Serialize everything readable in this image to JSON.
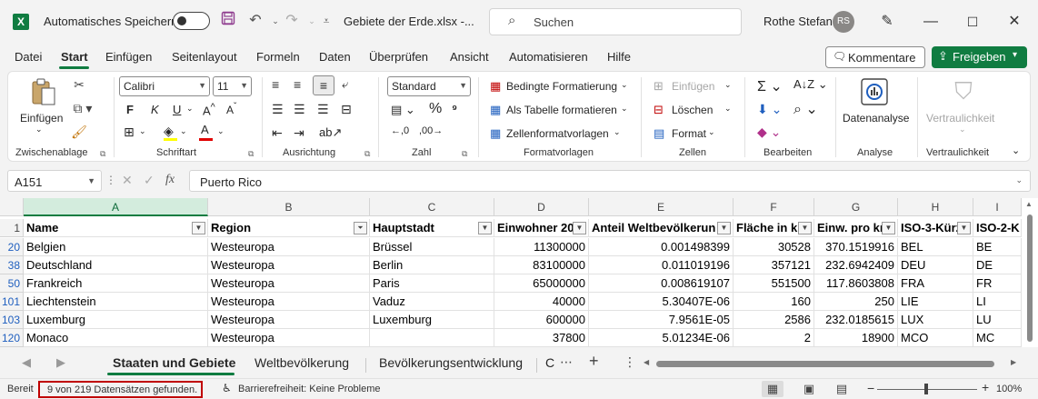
{
  "titlebar": {
    "autosave_label": "Automatisches Speichern",
    "file_title": "Gebiete der Erde.xlsx  -...",
    "search_placeholder": "Suchen",
    "user_name": "Rothe Stefan",
    "user_initials": "RS",
    "app_icon": "X"
  },
  "menu": {
    "tabs": [
      "Datei",
      "Start",
      "Einfügen",
      "Seitenlayout",
      "Formeln",
      "Daten",
      "Überprüfen",
      "Ansicht",
      "Automatisieren",
      "Hilfe"
    ],
    "active": "Start",
    "comment_label": "Kommentare",
    "share_label": "Freigeben"
  },
  "ribbon": {
    "clipboard": {
      "paste": "Einfügen",
      "label": "Zwischenablage"
    },
    "font": {
      "name": "Calibri",
      "size": "11",
      "label": "Schriftart",
      "bold": "F",
      "italic": "K",
      "underline": "U"
    },
    "alignment": {
      "label": "Ausrichtung"
    },
    "number": {
      "format": "Standard",
      "label": "Zahl"
    },
    "styles": {
      "conditional": "Bedingte Formatierung",
      "as_table": "Als Tabelle formatieren",
      "cell_styles": "Zellenformatvorlagen",
      "label": "Formatvorlagen"
    },
    "cells": {
      "insert": "Einfügen",
      "delete": "Löschen",
      "format": "Format",
      "label": "Zellen"
    },
    "editing": {
      "label": "Bearbeiten"
    },
    "analysis": {
      "button": "Datenanalyse",
      "label": "Analyse"
    },
    "sensitivity": {
      "button": "Vertraulichkeit",
      "label": "Vertraulichkeit"
    }
  },
  "formula_bar": {
    "name_box": "A151",
    "fx": "fx",
    "value": "Puerto Rico"
  },
  "grid": {
    "columns": [
      "A",
      "B",
      "C",
      "D",
      "E",
      "F",
      "G",
      "H",
      "I"
    ],
    "selected_column": "A",
    "header_row_number": "1",
    "headers": [
      "Name",
      "Region",
      "Hauptstadt",
      "Einwohner 20",
      "Anteil Weltbevölkerun",
      "Fläche in kı",
      "Einw. pro kı",
      "ISO-3-Kürz",
      "ISO-2-K"
    ],
    "rows": [
      {
        "row": "20",
        "cells": [
          "Belgien",
          "Westeuropa",
          "Brüssel",
          "11300000",
          "0.001498399",
          "30528",
          "370.1519916",
          "BEL",
          "BE"
        ]
      },
      {
        "row": "38",
        "cells": [
          "Deutschland",
          "Westeuropa",
          "Berlin",
          "83100000",
          "0.011019196",
          "357121",
          "232.6942409",
          "DEU",
          "DE"
        ]
      },
      {
        "row": "50",
        "cells": [
          "Frankreich",
          "Westeuropa",
          "Paris",
          "65000000",
          "0.008619107",
          "551500",
          "117.8603808",
          "FRA",
          "FR"
        ]
      },
      {
        "row": "101",
        "cells": [
          "Liechtenstein",
          "Westeuropa",
          "Vaduz",
          "40000",
          "5.30407E-06",
          "160",
          "250",
          "LIE",
          "LI"
        ]
      },
      {
        "row": "103",
        "cells": [
          "Luxemburg",
          "Westeuropa",
          "Luxemburg",
          "600000",
          "7.9561E-05",
          "2586",
          "232.0185615",
          "LUX",
          "LU"
        ]
      },
      {
        "row": "120",
        "cells": [
          "Monaco",
          "Westeuropa",
          "",
          "37800",
          "5.01234E-06",
          "2",
          "18900",
          "MCO",
          "MC"
        ]
      }
    ]
  },
  "sheets": {
    "tabs": [
      "Staaten und Gebiete",
      "Weltbevölkerung",
      "Bevölkerungsentwicklung",
      "C"
    ],
    "active": "Staaten und Gebiete"
  },
  "status": {
    "ready": "Bereit",
    "found": "9 von 219 Datensätzen gefunden.",
    "accessibility": "Barrierefreiheit: Keine Probleme",
    "zoom": "100%"
  }
}
